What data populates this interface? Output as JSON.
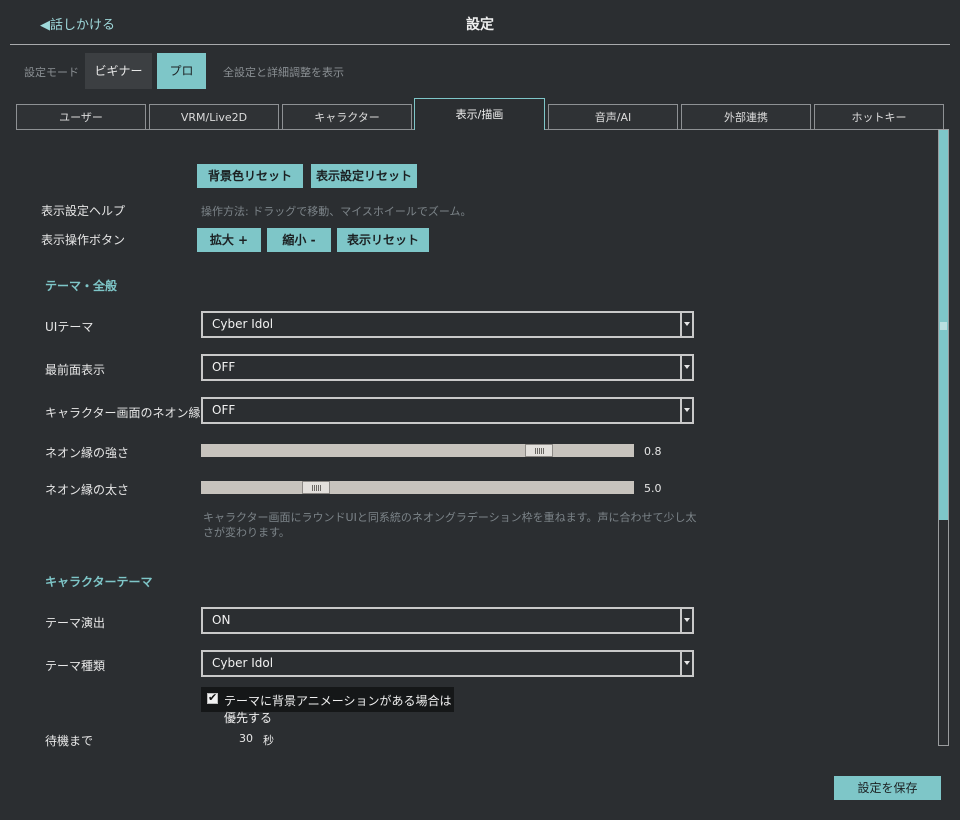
{
  "header": {
    "back_label": "◀話しかける",
    "title": "設定"
  },
  "mode": {
    "label": "設定モード",
    "beginner_label": "ビギナー",
    "pro_label": "プロ",
    "description": "全設定と詳細調整を表示"
  },
  "tabs": [
    {
      "label": "ユーザー"
    },
    {
      "label": "VRM/Live2D"
    },
    {
      "label": "キャラクター"
    },
    {
      "label": "表示/描画"
    },
    {
      "label": "音声/AI"
    },
    {
      "label": "外部連携"
    },
    {
      "label": "ホットキー"
    }
  ],
  "reset_buttons": {
    "bg_color_reset": "背景色リセット",
    "display_settings_reset": "表示設定リセット"
  },
  "display_help": {
    "label": "表示設定ヘルプ",
    "text": "操作方法: ドラッグで移動、マイスホイールでズーム。"
  },
  "display_ops": {
    "label": "表示操作ボタン",
    "zoom_in": "拡大 +",
    "zoom_out": "縮小 -",
    "reset": "表示リセット"
  },
  "theme_general": {
    "section_title": "テーマ・全般",
    "ui_theme": {
      "label": "UIテーマ",
      "value": "Cyber Idol"
    },
    "always_on_top": {
      "label": "最前面表示",
      "value": "OFF"
    },
    "neon_border": {
      "label": "キャラクター画面のネオン縁",
      "value": "OFF"
    },
    "neon_strength": {
      "label": "ネオン縁の強さ",
      "value": "0.8",
      "fraction": 0.8
    },
    "neon_width": {
      "label": "ネオン縁の太さ",
      "value": "5.0",
      "fraction": 0.25
    },
    "note_line1": "キャラクター画面にラウンドUIと同系統のネオングラデーション枠を重ねます。声に合わせて少し太",
    "note_line2": "さが変わります。"
  },
  "character_theme": {
    "section_title": "キャラクターテーマ",
    "theme_effect": {
      "label": "テーマ演出",
      "value": "ON"
    },
    "theme_type": {
      "label": "テーマ種類",
      "value": "Cyber Idol"
    },
    "prefer_bg_anim": {
      "label": "テーマに背景アニメーションがある場合は優先する",
      "checked": true
    },
    "idle_until": {
      "label": "待機まで",
      "value": "30",
      "unit": "秒"
    }
  },
  "footer": {
    "save_label": "設定を保存"
  },
  "colors": {
    "accent": "#7ec6c8",
    "background": "#2b2e31"
  }
}
